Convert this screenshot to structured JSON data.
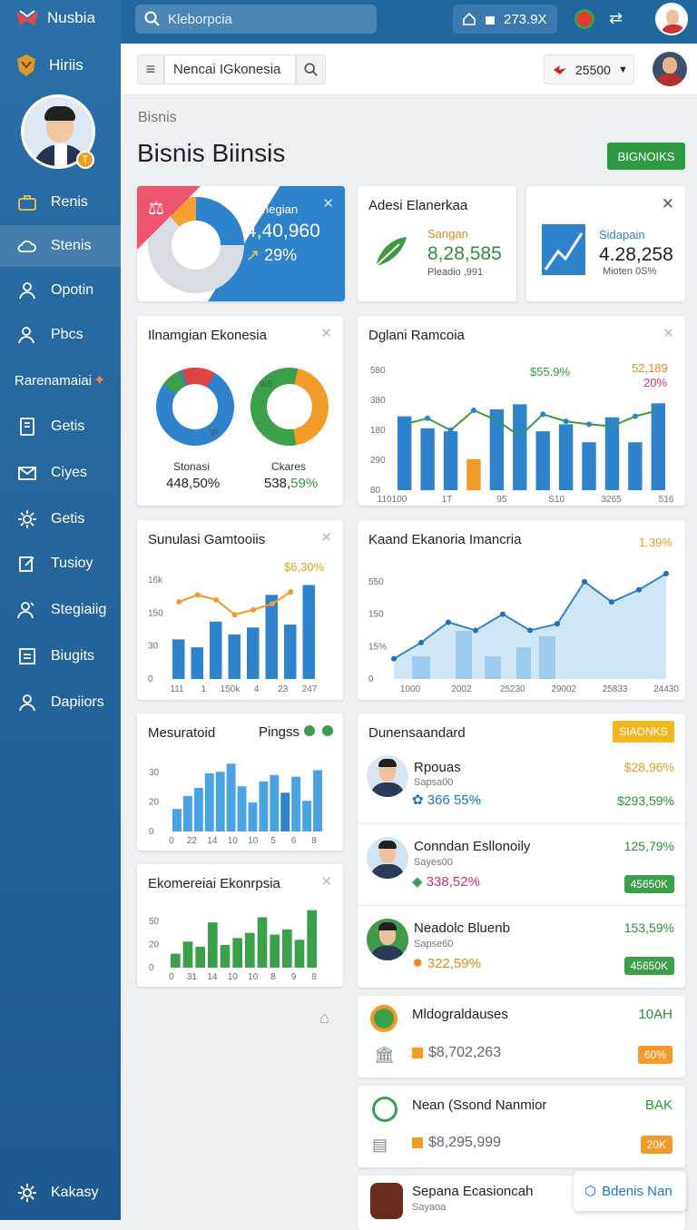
{
  "sidebar": {
    "brand": "Nusbia",
    "secondary": "Hiriis",
    "avatar_badge": "T",
    "items": [
      {
        "label": "Renis",
        "icon": "briefcase-icon"
      },
      {
        "label": "Stenis",
        "icon": "cloud-icon"
      },
      {
        "label": "Opotin",
        "icon": "user-icon"
      },
      {
        "label": "Pbcs",
        "icon": "user-check-icon"
      },
      {
        "label": "Rarenamaiai",
        "icon": "sparkle-icon"
      },
      {
        "label": "Getis",
        "icon": "document-icon"
      },
      {
        "label": "Ciyes",
        "icon": "mail-icon"
      },
      {
        "label": "Getis",
        "icon": "gear-icon"
      },
      {
        "label": "Tusioy",
        "icon": "edit-icon"
      },
      {
        "label": "Stegiaiig",
        "icon": "users-icon"
      },
      {
        "label": "Biugits",
        "icon": "list-icon"
      },
      {
        "label": "Dapiiors",
        "icon": "person-icon"
      }
    ],
    "bottom": "Kakasy"
  },
  "topbar": {
    "search_placeholder": "Kleborpcia",
    "counter": "273.9X"
  },
  "subbar": {
    "input_value": "Nencai IGkonesia",
    "balance": "25500"
  },
  "breadcrumb": "Bisnis",
  "page_title": "Bisnis Biinsis",
  "action_button": "BIGNOIKS",
  "stat_cards": {
    "blue": {
      "label": "Manegian",
      "value": "4,40,960",
      "change": "29%"
    },
    "leaf": {
      "title": "Adesi Elanerkaa",
      "label": "Sangan",
      "value": "8,28,585",
      "sub": "Pleadio ,991"
    },
    "trend": {
      "label": "Sidapain",
      "value": "4.28,258",
      "sub": "Mioten 0S%"
    }
  },
  "donut_card": {
    "title": "Ilnamgian Ekonesia",
    "left": {
      "label": "Stonasi",
      "value": "448,50%",
      "inner": "'g5"
    },
    "right": {
      "label": "Ckares",
      "value_main": "538,",
      "value_highlight": "59%",
      "inner": "9/5"
    }
  },
  "chart_data": [
    {
      "type": "bar",
      "title": "Dglani Ramcoia",
      "ylabels": [
        "580",
        "380",
        "180",
        "290",
        "80"
      ],
      "xlabels": [
        "110100",
        "1T",
        "95",
        "S10",
        "3265",
        "516"
      ],
      "values": [
        370,
        310,
        295,
        155,
        405,
        430,
        295,
        330,
        240,
        365,
        240,
        435
      ],
      "highlight_index": 3,
      "line": [
        330,
        360,
        300,
        400,
        350,
        270,
        380,
        345,
        330,
        320,
        370,
        400
      ],
      "annotation_a": "$55.9%",
      "annotation_b": "52,189",
      "annotation_c": "20%"
    },
    {
      "type": "bar",
      "title": "Sunulasi Gamtooiis",
      "ylabels": [
        "16k",
        "150",
        "30",
        "0"
      ],
      "xlabels": [
        "111",
        "1",
        "150k",
        "4",
        "23",
        "247"
      ],
      "values": [
        40,
        32,
        58,
        45,
        52,
        85,
        55,
        95
      ],
      "line": [
        78,
        85,
        80,
        65,
        70,
        76,
        88
      ],
      "annotation": "$6,30%"
    },
    {
      "type": "area",
      "title": "Kaand Ekanoria Imancria",
      "ylabels": [
        "550",
        "150",
        "15%",
        "0"
      ],
      "xlabels": [
        "1000",
        "2002",
        "25230",
        "29002",
        "25833",
        "24430"
      ],
      "values": [
        25,
        45,
        70,
        60,
        80,
        60,
        68,
        120,
        95,
        110,
        130
      ],
      "annotation": "1.39%"
    },
    {
      "type": "bar",
      "title": "Mesuratoid",
      "legend": "Pingss",
      "ylabels": [
        "30",
        "20",
        "0"
      ],
      "xlabels": [
        "0",
        "22",
        "14",
        "10",
        "10",
        "5",
        "6",
        "8"
      ],
      "values": [
        14,
        22,
        27,
        36,
        37,
        42,
        28,
        18,
        31,
        35,
        24,
        34,
        19,
        38
      ]
    },
    {
      "type": "bar",
      "title": "Ekomereiai Ekonrpsia",
      "ylabels": [
        "50",
        "20",
        "0"
      ],
      "xlabels": [
        "0",
        "31",
        "14",
        "10",
        "10",
        "8",
        "9",
        "8"
      ],
      "values": [
        8,
        15,
        12,
        26,
        13,
        17,
        20,
        29,
        19,
        22,
        16,
        33
      ]
    }
  ],
  "leaderboard": {
    "title": "Dunensaandard",
    "badge": "SIAONKS",
    "rows": [
      {
        "name": "Rpouas",
        "sub": "Sapsa00",
        "metric": "366 55%",
        "right_top": "$28,96%",
        "right_bottom": "$293,59%",
        "pill": ""
      },
      {
        "name": "Conndan Esllonoily",
        "sub": "Sayes00",
        "metric": "338,52%",
        "right_top": "125,79%",
        "right_bottom": "",
        "pill": "45650K"
      },
      {
        "name": "Neadolc Bluenb",
        "sub": "Sapse60",
        "metric": "322,59%",
        "right_top": "153,59%",
        "right_bottom": "",
        "pill": "45650K"
      }
    ]
  },
  "mini_cards": [
    {
      "name": "Mldograldauses",
      "value": "$8,702,263",
      "right": "10AH",
      "pill": "60%"
    },
    {
      "name": "Nean (Ssond Nanmior",
      "value": "$8,295,999",
      "right": "BAK",
      "pill": "20K"
    },
    {
      "name": "Sepana Ecasioncah",
      "sub": "Sayaoa"
    }
  ],
  "float_button": "Bdenis Nan"
}
